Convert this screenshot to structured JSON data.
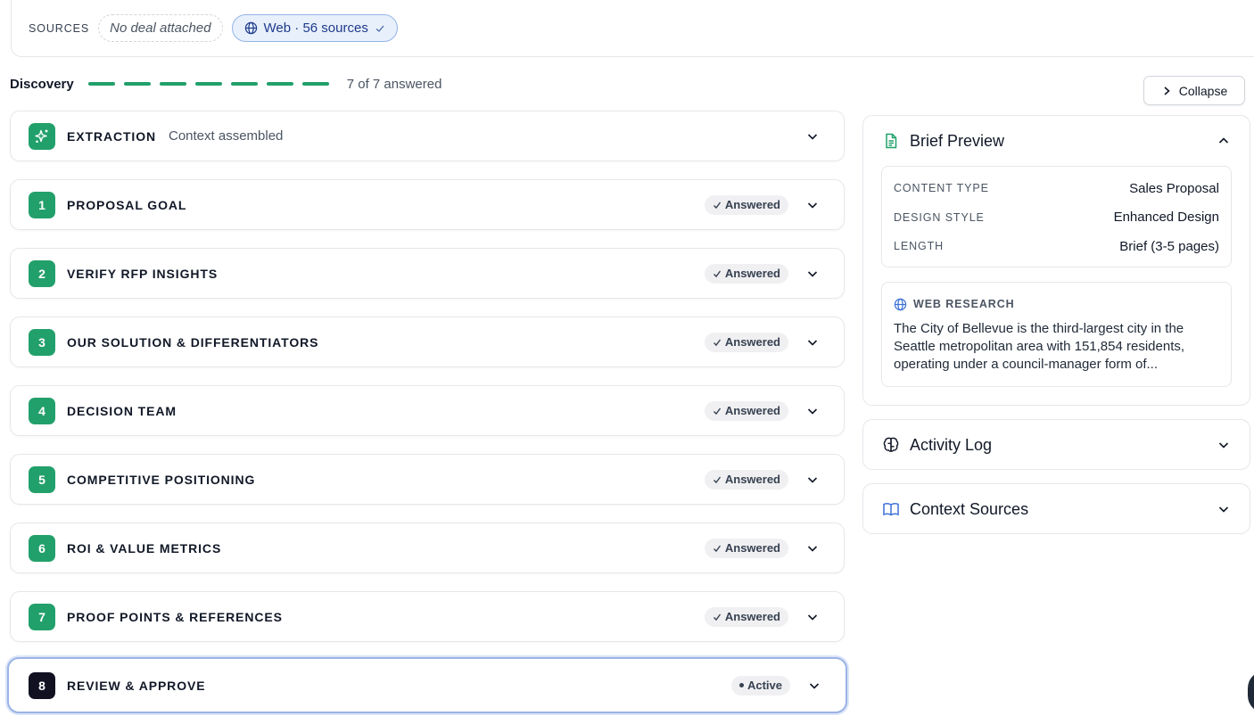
{
  "sources": {
    "label": "SOURCES",
    "no_deal": "No deal attached",
    "web_chip": "Web · 56 sources"
  },
  "discovery": {
    "title": "Discovery",
    "progress": {
      "answered": 7,
      "total": 7
    },
    "count_text": "7 of 7 answered",
    "accent_color": "#22a06b"
  },
  "collapse_label": "Collapse",
  "extraction": {
    "title": "EXTRACTION",
    "subtitle": "Context assembled"
  },
  "steps": [
    {
      "num": "1",
      "title": "PROPOSAL GOAL",
      "status": "Answered"
    },
    {
      "num": "2",
      "title": "VERIFY RFP INSIGHTS",
      "status": "Answered"
    },
    {
      "num": "3",
      "title": "OUR SOLUTION & DIFFERENTIATORS",
      "status": "Answered"
    },
    {
      "num": "4",
      "title": "DECISION TEAM",
      "status": "Answered"
    },
    {
      "num": "5",
      "title": "COMPETITIVE POSITIONING",
      "status": "Answered"
    },
    {
      "num": "6",
      "title": "ROI & VALUE METRICS",
      "status": "Answered"
    },
    {
      "num": "7",
      "title": "PROOF POINTS & REFERENCES",
      "status": "Answered"
    },
    {
      "num": "8",
      "title": "REVIEW & APPROVE",
      "status": "Active"
    }
  ],
  "brief_preview": {
    "title": "Brief Preview",
    "rows": [
      {
        "key": "CONTENT TYPE",
        "value": "Sales Proposal"
      },
      {
        "key": "DESIGN STYLE",
        "value": "Enhanced Design"
      },
      {
        "key": "LENGTH",
        "value": "Brief (3-5 pages)"
      }
    ],
    "web_research": {
      "label": "WEB RESEARCH",
      "text": "The City of Bellevue is the third-largest city in the Seattle metropolitan area with 151,854 residents, operating under a council-manager form of..."
    }
  },
  "activity_log": {
    "title": "Activity Log"
  },
  "context_sources": {
    "title": "Context Sources"
  }
}
